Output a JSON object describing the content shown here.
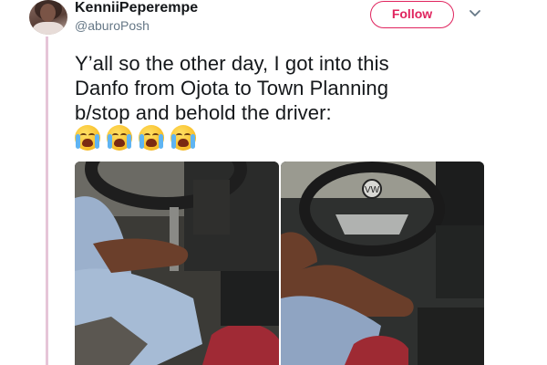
{
  "tweet": {
    "author": {
      "display_name": "KenniiPeperempe",
      "handle": "@aburoPosh"
    },
    "follow_label": "Follow",
    "text_lines": [
      "Y’all so the other day, I got into this",
      "Danfo from Ojota to Town Planning",
      "b/stop and behold the driver:"
    ],
    "emojis": [
      "loudly-crying-face",
      "loudly-crying-face",
      "loudly-crying-face",
      "loudly-crying-face"
    ],
    "media": [
      {
        "name": "driver-photo-left",
        "description_icon": "photo"
      },
      {
        "name": "driver-photo-right",
        "description_icon": "photo"
      }
    ]
  },
  "colors": {
    "follow_accent": "#e0245e",
    "thread_line": "#e6c5d8",
    "handle_gray": "#657786"
  }
}
